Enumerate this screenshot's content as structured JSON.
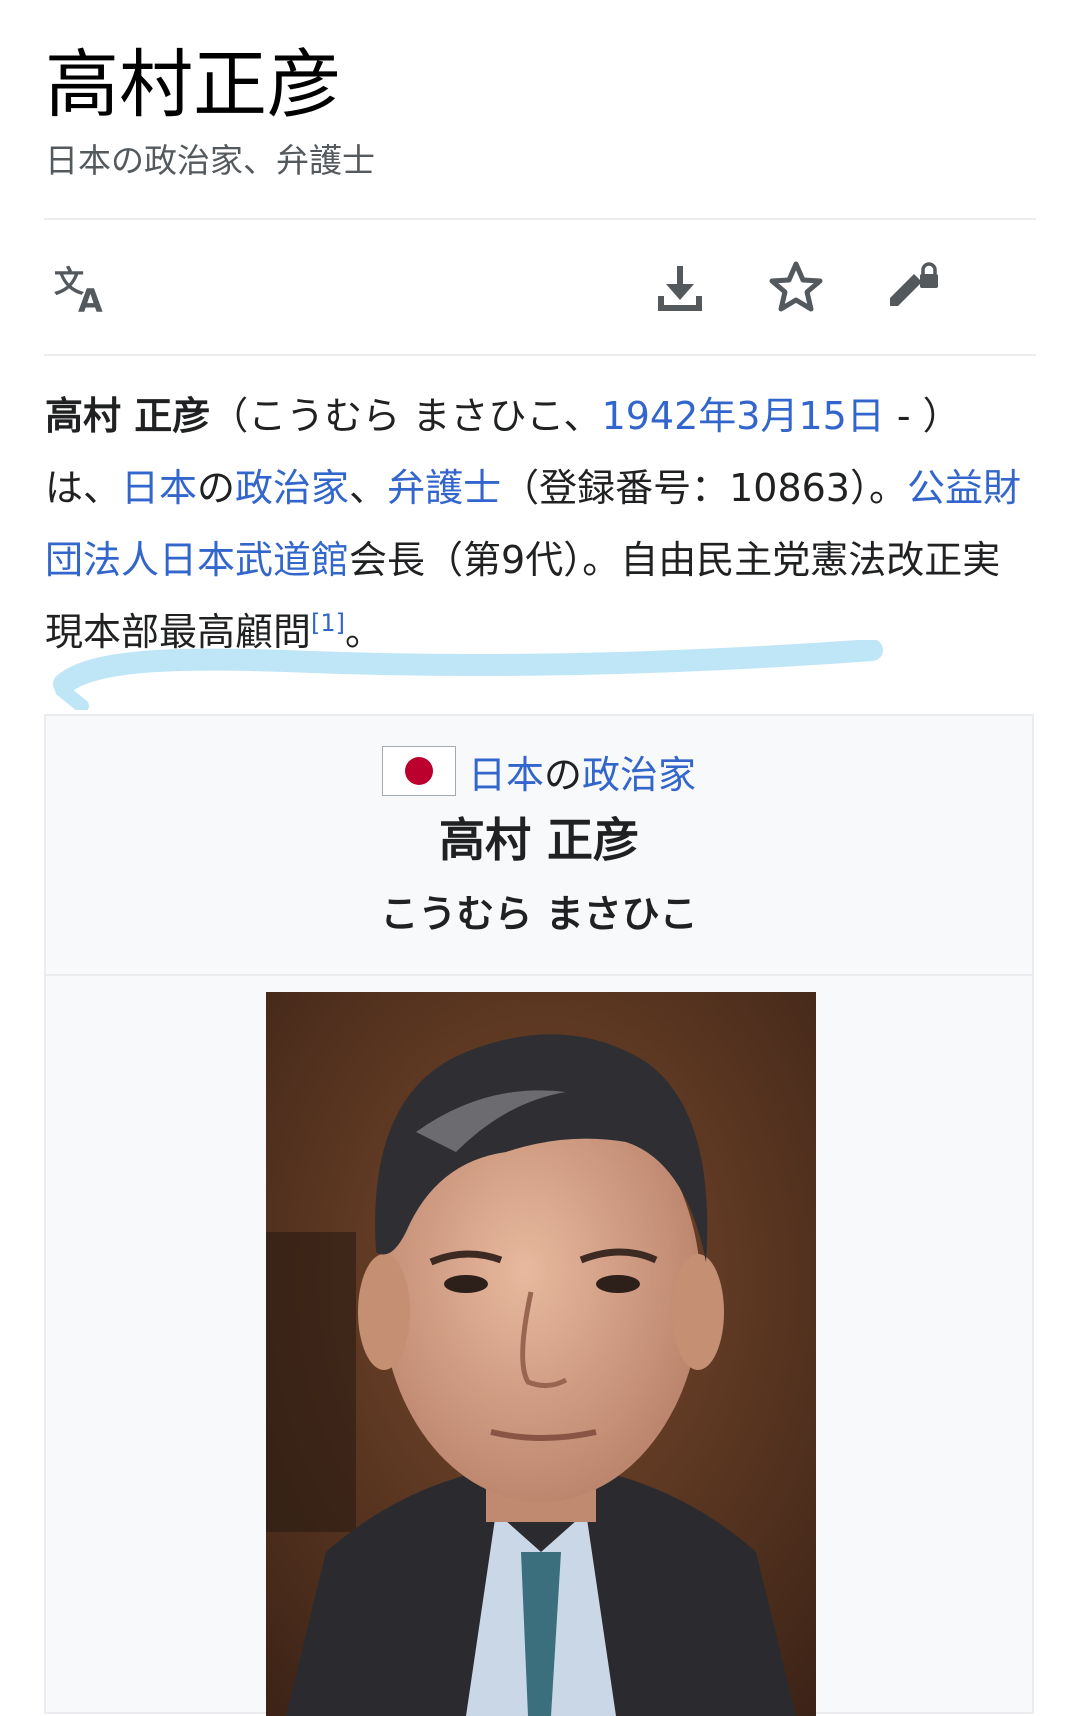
{
  "page": {
    "title": "高村正彦",
    "description": "日本の政治家、弁護士"
  },
  "toolbar": {
    "language_icon": "translate-icon",
    "download_icon": "download-icon",
    "watch_icon": "star-icon",
    "edit_icon": "edit-lock-icon"
  },
  "lead": {
    "name": "高村 正彦",
    "reading": "（こうむら まさひこ、",
    "birth_date": "1942年3月15日",
    "dash": " - ）は、",
    "link_japan": "日本",
    "no": "の",
    "link_politician": "政治家",
    "comma": "、",
    "link_lawyer": "弁護士",
    "registration": "（登録番号：10863）。",
    "link_budokan": "公益財団法人日本武道館",
    "chairman": "会長（第9代）。自由民主党憲法改正実現本部最高顧問",
    "ref": "[1]",
    "end": "。"
  },
  "colors": {
    "link": "#3366cc",
    "highlight": "#bfe6f7",
    "flag_red": "#bc002d"
  },
  "infobox": {
    "flag_icon": "japan-flag-icon",
    "category_link_1": "日本",
    "category_no": "の",
    "category_link_2": "政治家",
    "name": "高村 正彦",
    "reading": "こうむら まさひこ",
    "photo": "portrait-photo"
  }
}
